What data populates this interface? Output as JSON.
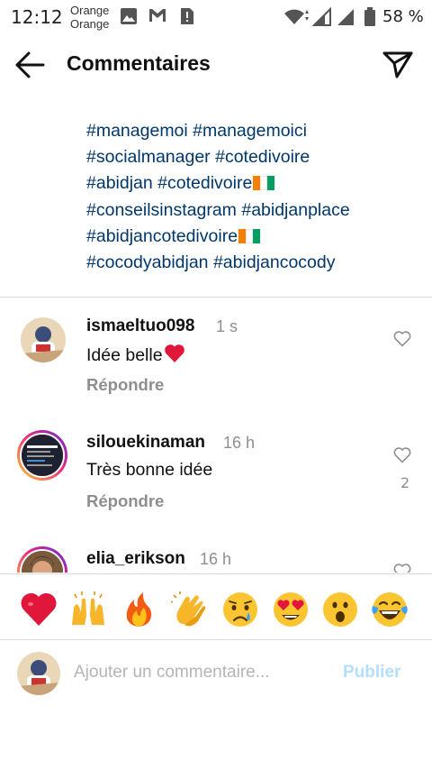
{
  "status_bar": {
    "time": "12:12",
    "carrier_line1": "Orange",
    "carrier_line2": "Orange",
    "battery": "58 %",
    "icons": [
      "image-icon",
      "gmail-icon",
      "sim-alert-icon",
      "wifi-icon",
      "signal-icon",
      "battery-icon"
    ]
  },
  "header": {
    "title": "Commentaires",
    "back_icon": "arrow-left-icon",
    "share_icon": "paper-plane-icon"
  },
  "caption": {
    "lines": [
      [
        "#managemoi",
        "#managemoici"
      ],
      [
        "#socialmanager",
        "#cotedivoire"
      ],
      [
        "#abidjan",
        "#cotedivoire"
      ],
      [
        "#conseilsinstagram",
        "#abidjanplace"
      ],
      [
        "#abidjancotedivoire"
      ],
      [
        "#cocodyabidjan",
        "#abidjancocody"
      ]
    ],
    "flag_after_line": [
      false,
      false,
      true,
      false,
      true,
      false
    ],
    "flag_colors": [
      "#f77f00",
      "#ffffff",
      "#009e60"
    ]
  },
  "comments": [
    {
      "username": "ismaeltuo098",
      "time": "1 s",
      "text": "Idée belle",
      "has_heart": true,
      "reply_label": "Répondre",
      "likes": "",
      "story_ring": false
    },
    {
      "username": "silouekinaman",
      "time": "16 h",
      "text": "Très bonne idée",
      "has_heart": false,
      "reply_label": "Répondre",
      "likes": "2",
      "story_ring": true
    },
    {
      "username": "elia_erikson",
      "time": "16 h",
      "text": "",
      "has_heart": false,
      "reply_label": "",
      "likes": "",
      "story_ring": true
    }
  ],
  "emoji_bar": [
    "red-heart",
    "raising-hands",
    "fire",
    "clapping-hands",
    "crying-face",
    "heart-eyes-face",
    "open-mouth-face",
    "tears-of-joy-face"
  ],
  "composer": {
    "placeholder": "Ajouter un commentaire...",
    "publish_label": "Publier"
  },
  "colors": {
    "hashtag": "#00376b",
    "muted": "#8e8e8e",
    "publish_disabled": "#b2dffc",
    "heart": "#e0163a"
  }
}
